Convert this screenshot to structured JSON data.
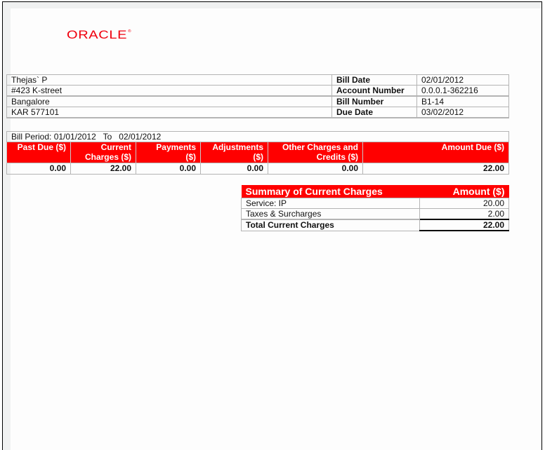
{
  "brand": {
    "logo_text": "ORACLE",
    "logo_mark": "®",
    "color": "#f0000e"
  },
  "customer": {
    "name": "Thejas` P",
    "address_line1": "#423 K-street",
    "city": "Bangalore",
    "state_zip": "KAR 577101"
  },
  "bill_info": [
    {
      "label": "Bill Date",
      "value": "02/01/2012"
    },
    {
      "label": "Account Number",
      "value": "0.0.0.1-362216"
    },
    {
      "label": "Bill Number",
      "value": "B1-14"
    },
    {
      "label": "Due Date",
      "value": "03/02/2012"
    }
  ],
  "bill_period": {
    "label": "Bill Period:",
    "from": "01/01/2012",
    "to_label": "To",
    "to": "02/01/2012"
  },
  "charges_table": {
    "header_color": "#ff0000",
    "headers": [
      [
        "Past Due ($)",
        ""
      ],
      [
        "Current",
        "Charges ($)"
      ],
      [
        "Payments",
        "($)"
      ],
      [
        "Adjustments",
        "($)"
      ],
      [
        "Other Charges and",
        "Credits ($)"
      ],
      [
        "Amount Due ($)",
        ""
      ]
    ],
    "values": [
      "0.00",
      "22.00",
      "0.00",
      "0.00",
      "0.00",
      "22.00"
    ]
  },
  "summary": {
    "title": "Summary of Current Charges",
    "amount_header": "Amount ($)",
    "rows": [
      {
        "label": "Service: IP",
        "amount": "20.00"
      },
      {
        "label": "Taxes & Surcharges",
        "amount": "2.00"
      }
    ],
    "total": {
      "label": "Total Current Charges",
      "amount": "22.00"
    }
  }
}
